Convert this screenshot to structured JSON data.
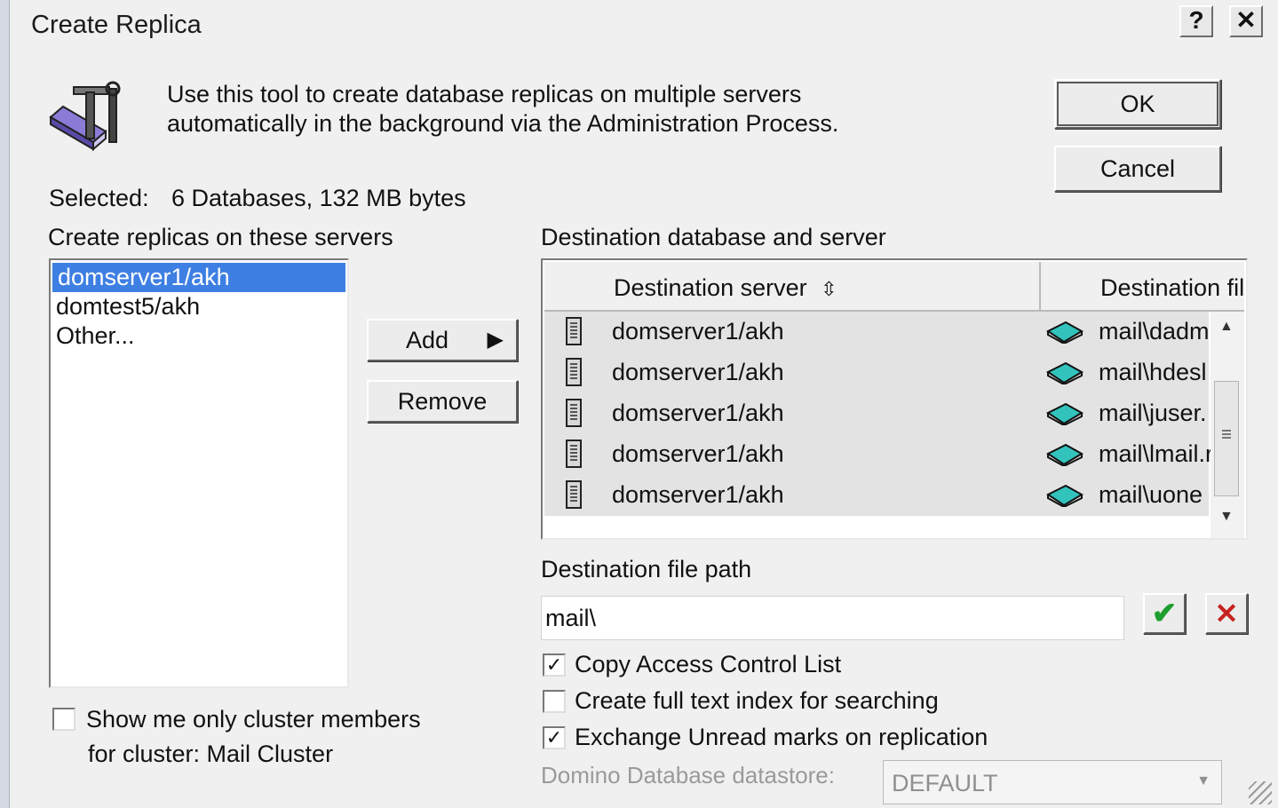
{
  "window": {
    "title": "Create Replica",
    "help_label": "?",
    "close_label": "✕"
  },
  "intro": {
    "line1": "Use this tool to create database replicas on multiple servers",
    "line2": "automatically in the background via the Administration Process.",
    "icon": "admin-tools-icon"
  },
  "buttons": {
    "ok": "OK",
    "cancel": "Cancel",
    "add": "Add",
    "add_arrow": "▶",
    "remove": "Remove"
  },
  "selected": {
    "label": "Selected:",
    "value": "6 Databases, 132 MB bytes"
  },
  "servers": {
    "label": "Create replicas on these servers",
    "items": [
      "domserver1/akh",
      "domtest5/akh",
      "Other..."
    ],
    "selected_index": 0
  },
  "destination": {
    "label": "Destination database and server",
    "columns": [
      "Destination server",
      "Destination fil"
    ],
    "sort_icon": "⇳",
    "rows": [
      {
        "server": "domserver1/akh",
        "file": "mail\\dadm"
      },
      {
        "server": "domserver1/akh",
        "file": "mail\\hdesl"
      },
      {
        "server": "domserver1/akh",
        "file": "mail\\juser."
      },
      {
        "server": "domserver1/akh",
        "file": "mail\\lmail.r"
      },
      {
        "server": "domserver1/akh",
        "file": "mail\\uone"
      }
    ]
  },
  "path": {
    "label": "Destination file path",
    "value": "mail\\",
    "accept_icon": "✔",
    "cancel_icon": "✕"
  },
  "options": {
    "copy_acl": {
      "label": "Copy Access Control List",
      "checked": true
    },
    "full_text": {
      "label": "Create full text index for searching",
      "checked": false
    },
    "unread": {
      "label": "Exchange Unread marks on replication",
      "checked": true
    }
  },
  "datastore": {
    "label": "Domino Database datastore:",
    "value": "DEFAULT"
  },
  "cluster": {
    "line1": "Show me only cluster members",
    "line2": "for cluster: Mail Cluster",
    "checked": false
  },
  "colors": {
    "selection": "#3e7fe3",
    "check_green": "#1f9e2f",
    "cross_red": "#c62222",
    "book_teal": "#33c3bd"
  }
}
